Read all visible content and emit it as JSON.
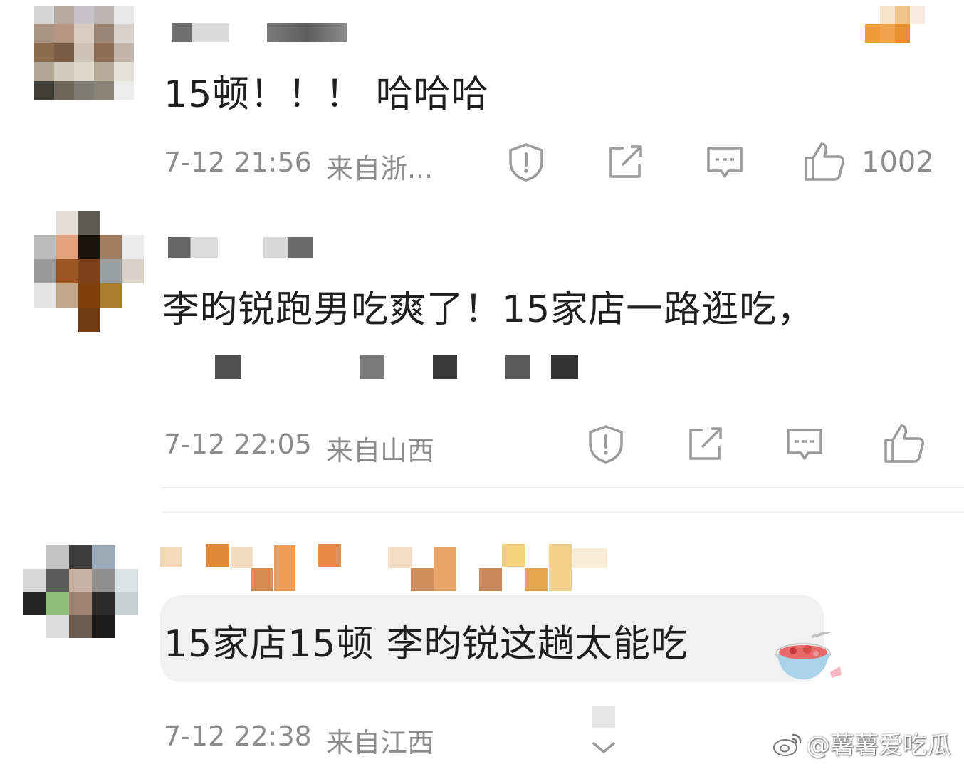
{
  "comments": [
    {
      "text": "15顿！！！ 哈哈哈",
      "time": "7-12 21:56",
      "location": "来自浙...",
      "likes": "1002"
    },
    {
      "text": "李昀锐跑男吃爽了！15家店一路逛吃，",
      "time": "7-12 22:05",
      "location": "来自山西",
      "likes": ""
    },
    {
      "text": "15家店15顿 李昀锐这趟太能吃",
      "time": "7-12 22:38",
      "location": "来自江西"
    }
  ],
  "watermark": "@薯薯爱吃瓜",
  "icons": [
    "report-icon",
    "share-icon",
    "reply-icon",
    "like-icon",
    "weibo-logo-icon",
    "chevron-down-icon"
  ]
}
